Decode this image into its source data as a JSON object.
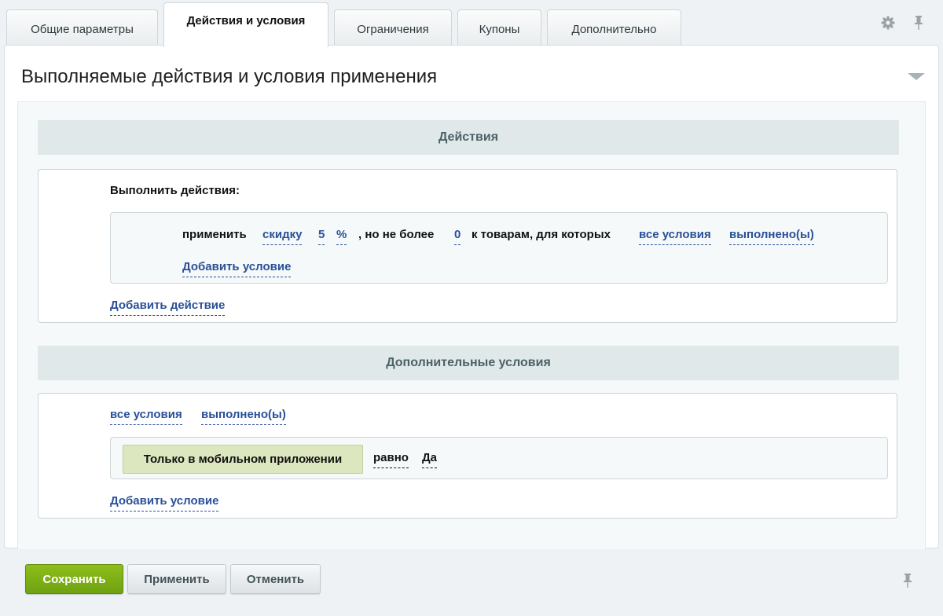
{
  "tabs": [
    {
      "label": "Общие параметры"
    },
    {
      "label": "Действия и условия"
    },
    {
      "label": "Ограничения"
    },
    {
      "label": "Купоны"
    },
    {
      "label": "Дополнительно"
    }
  ],
  "active_tab": "Действия и условия",
  "icons": {
    "settings": "gear-icon",
    "pin": "pin-icon",
    "collapse": "triangle-down-icon"
  },
  "panel": {
    "title": "Выполняемые действия и условия применения"
  },
  "actions_section": {
    "header": "Действия",
    "label": "Выполнить действия:",
    "rule": {
      "apply": "применить",
      "discount_type": "скидку",
      "amount": "5",
      "unit": "%",
      "no_more_than": ", но не более",
      "limit": "0",
      "to_items": "к товарам, для которых",
      "conditions_mode": "все условия",
      "conditions_state": "выполнено(ы)",
      "add_condition": "Добавить условие"
    },
    "add_action": "Добавить действие"
  },
  "extra_section": {
    "header": "Дополнительные условия",
    "conditions_mode": "все условия",
    "conditions_state": "выполнено(ы)",
    "condition": {
      "name": "Только в мобильном приложении",
      "operator": "равно",
      "value": "Да"
    },
    "add_condition": "Добавить условие"
  },
  "buttons": {
    "save": "Сохранить",
    "apply": "Применить",
    "cancel": "Отменить"
  },
  "colors": {
    "accent_green": "#7ab317",
    "link_blue": "#2a5098",
    "condition_bg": "#dde7bf"
  }
}
